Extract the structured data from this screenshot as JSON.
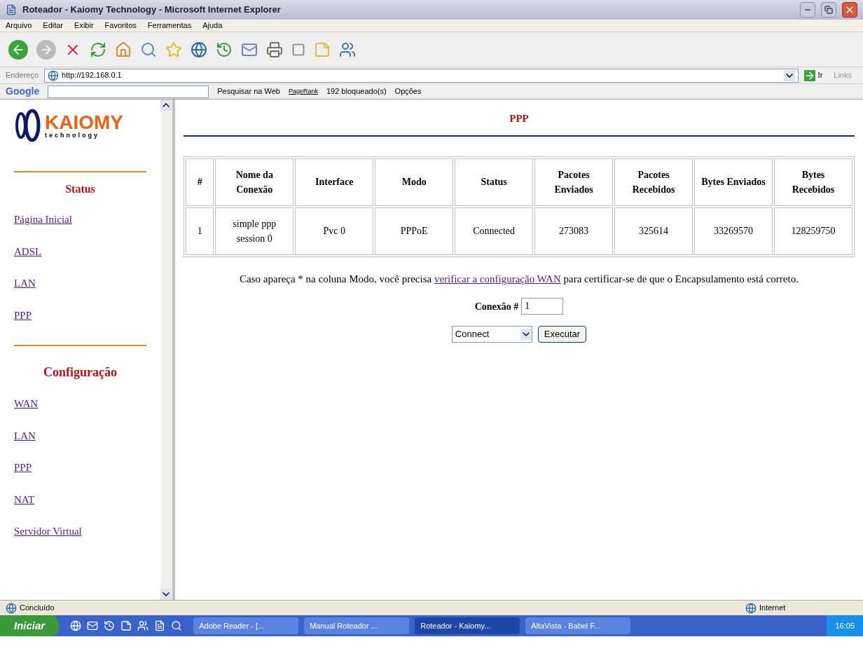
{
  "window": {
    "title": "Roteador - Kaiomy Technology - Microsoft Internet Explorer"
  },
  "menu": [
    "Arquivo",
    "Editar",
    "Exibir",
    "Favoritos",
    "Ferramentas",
    "Ajuda"
  ],
  "address": {
    "label": "Endereço",
    "value": "http://192.168.0.1",
    "go": "Ir",
    "links": "Links"
  },
  "google_bar": {
    "logo": "Google",
    "search": "Pesquisar na Web",
    "pagerank": "PageRank",
    "blocked": "192 bloqueado(s)",
    "options": "Opções"
  },
  "sidebar": {
    "logo": {
      "name": "KAIOMY",
      "tagline": "technology"
    },
    "sections": [
      {
        "heading": "Status",
        "links": [
          "Página Inicial",
          "ADSL",
          "LAN",
          "PPP"
        ]
      },
      {
        "heading": "Configuração",
        "links": [
          "WAN",
          "LAN",
          "PPP",
          "NAT",
          "Servidor Virtual"
        ]
      }
    ]
  },
  "main": {
    "title": "PPP",
    "table": {
      "columns": [
        "#",
        "Nome da Conexão",
        "Interface",
        "Modo",
        "Status",
        "Pacotes Enviados",
        "Pacotes Recebidos",
        "Bytes Enviados",
        "Bytes Recebidos"
      ],
      "rows": [
        [
          "1",
          "simple ppp session 0",
          "Pvc 0",
          "PPPoE",
          "Connected",
          "273083",
          "325614",
          "33269570",
          "128259750"
        ]
      ]
    },
    "note": {
      "before": "Caso apareça * na coluna Modo, você precisa ",
      "link": "verificar a configuração WAN",
      "after": " para certificar-se de que o Encapsulamento está correto."
    },
    "connection": {
      "label": "Conexão #",
      "value": "1"
    },
    "action": {
      "value": "Connect",
      "button": "Executar"
    }
  },
  "status_bar": {
    "text": "Concluído",
    "zone": "Internet"
  },
  "taskbar": {
    "start": "Iniciar",
    "tasks": [
      {
        "label": "Adobe Reader - [...",
        "selected": false
      },
      {
        "label": "Manual Roteador ...",
        "selected": false
      },
      {
        "label": "Roteador - Kaiomy...",
        "selected": true
      },
      {
        "label": "AltaVista - Babel F...",
        "selected": false
      }
    ],
    "clock": "16:05"
  }
}
